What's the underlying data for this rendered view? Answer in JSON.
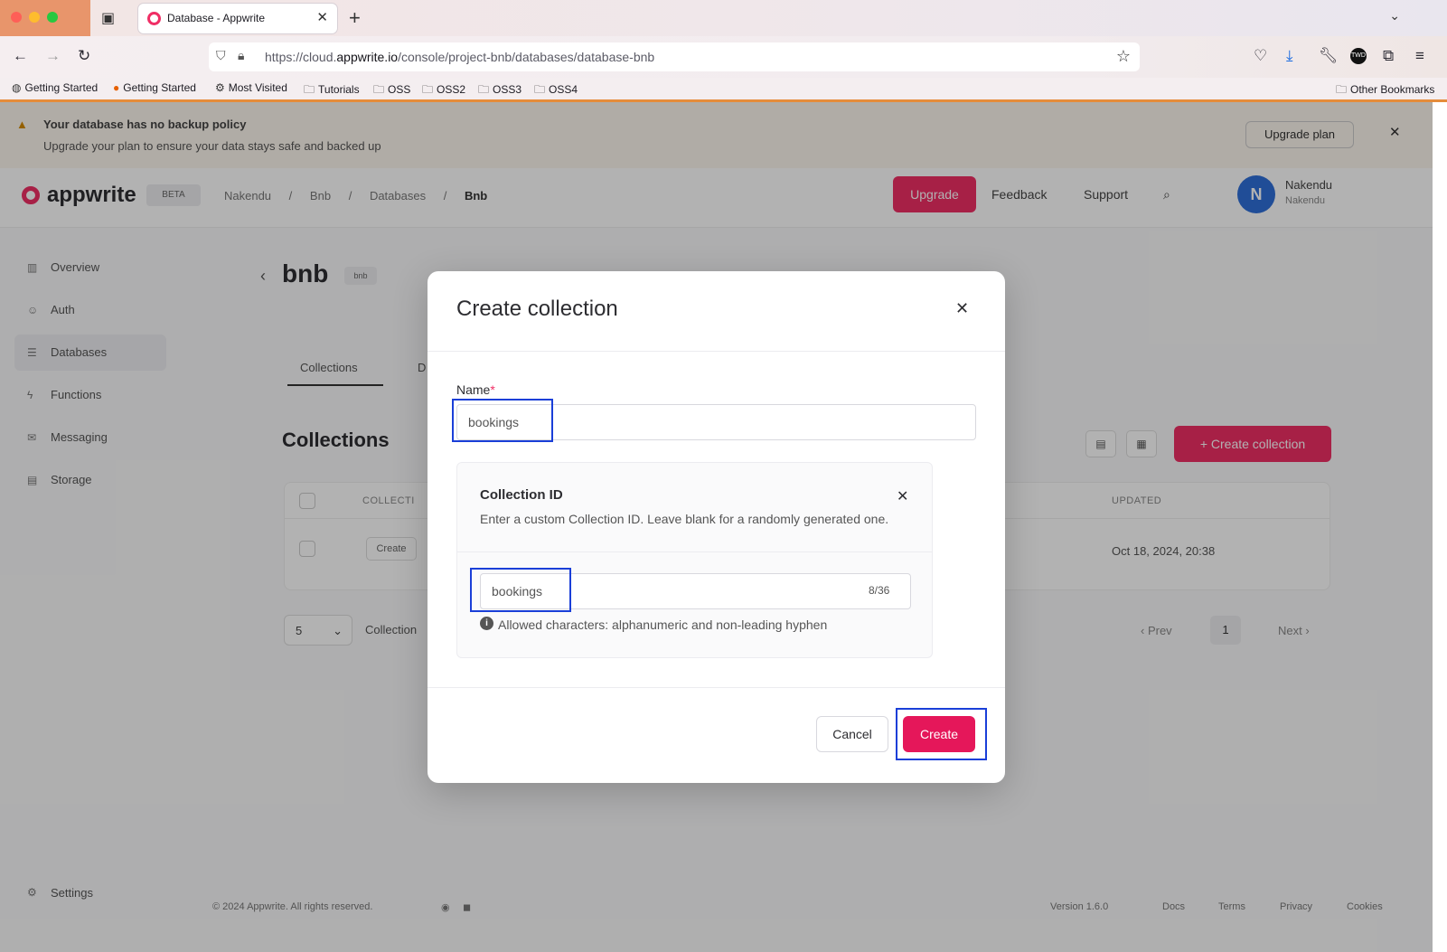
{
  "browser": {
    "tab_title": "Database - Appwrite",
    "url_prefix": "https://cloud.",
    "url_domain": "appwrite.io",
    "url_path": "/console/project-bnb/databases/database-bnb",
    "bookmarks": [
      "Getting Started",
      "Getting Started",
      "Most Visited",
      "Tutorials",
      "OSS",
      "OSS2",
      "OSS3",
      "OSS4"
    ],
    "other_bookmarks": "Other Bookmarks"
  },
  "banner": {
    "title": "Your database has no backup policy",
    "text": "Upgrade your plan to ensure your data stays safe and backed up",
    "button": "Upgrade plan"
  },
  "header": {
    "logo": "appwrite",
    "badge": "BETA",
    "crumbs": [
      "Nakendu",
      "/",
      "Bnb",
      "/",
      "Databases",
      "/",
      "Bnb"
    ],
    "upgrade": "Upgrade",
    "feedback": "Feedback",
    "support": "Support",
    "avatar_initial": "N",
    "user_name": "Nakendu",
    "user_org": "Nakendu"
  },
  "sidebar": {
    "items": [
      "Overview",
      "Auth",
      "Databases",
      "Functions",
      "Messaging",
      "Storage"
    ],
    "settings": "Settings"
  },
  "page": {
    "title": "bnb",
    "badge": "bnb",
    "tabs": [
      "Collections",
      "D"
    ],
    "heading": "Collections",
    "create_button": "+ Create collection",
    "table_headers": [
      "COLLECTI",
      "UPDATED"
    ],
    "row_id": "Create",
    "row_updated": "Oct 18, 2024, 20:38",
    "page_size": "5",
    "collections_label": "Collection",
    "prev": "Prev",
    "page_num": "1",
    "next": "Next"
  },
  "footer": {
    "copyright": "© 2024 Appwrite. All rights reserved.",
    "links": [
      "Docs",
      "Terms",
      "Privacy",
      "Cookies"
    ],
    "version": "Version 1.6.0"
  },
  "modal": {
    "title": "Create collection",
    "name_label": "Name",
    "name_required": "*",
    "name_value": "bookings",
    "cid_title": "Collection ID",
    "cid_desc": "Enter a custom Collection ID. Leave blank for a randomly generated one.",
    "cid_value": "bookings",
    "cid_count": "8/36",
    "cid_hint": "Allowed characters: alphanumeric and non-leading hyphen",
    "cancel": "Cancel",
    "create": "Create"
  },
  "colors": {
    "brand": "#f02e65",
    "highlight": "#1a3fd8"
  }
}
